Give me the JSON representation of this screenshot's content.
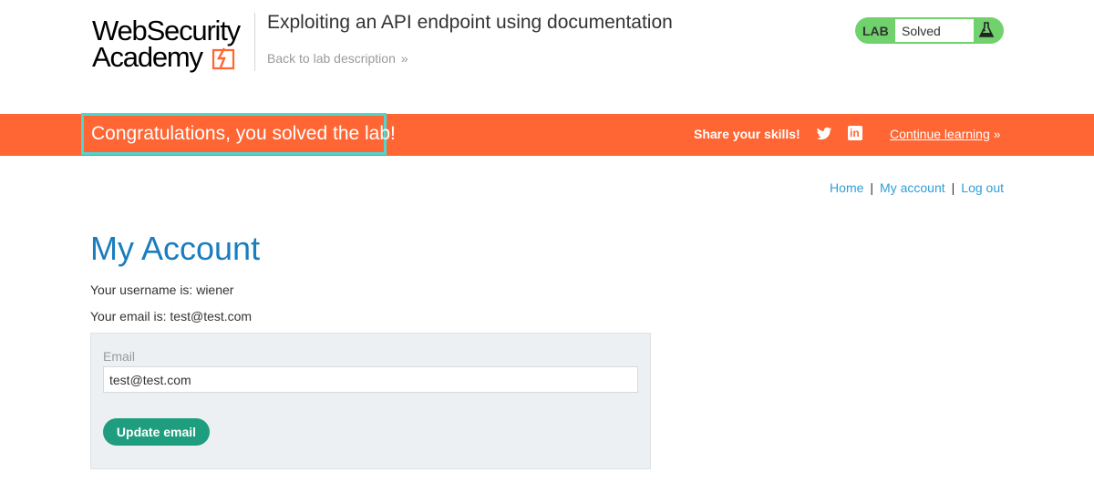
{
  "header": {
    "logo_line1": "WebSecurity",
    "logo_line2": "Academy",
    "lab_title": "Exploiting an API endpoint using documentation",
    "back_link": "Back to lab description",
    "back_chevron": "»",
    "lab_label": "LAB",
    "status": "Solved",
    "status_icon": "flask-icon"
  },
  "banner": {
    "congrats": "Congratulations, you solved the lab!",
    "share": "Share your skills!",
    "continue": "Continue learning",
    "continue_chevron": "»",
    "accent_color": "#ff6633"
  },
  "nav": {
    "home": "Home",
    "sep": "|",
    "my_account": "My account",
    "log_out": "Log out"
  },
  "main": {
    "title": "My Account",
    "username_line": "Your username is: wiener",
    "email_line": "Your email is: test@test.com"
  },
  "form": {
    "email_label": "Email",
    "email_value": "test@test.com",
    "update_button": "Update email"
  }
}
